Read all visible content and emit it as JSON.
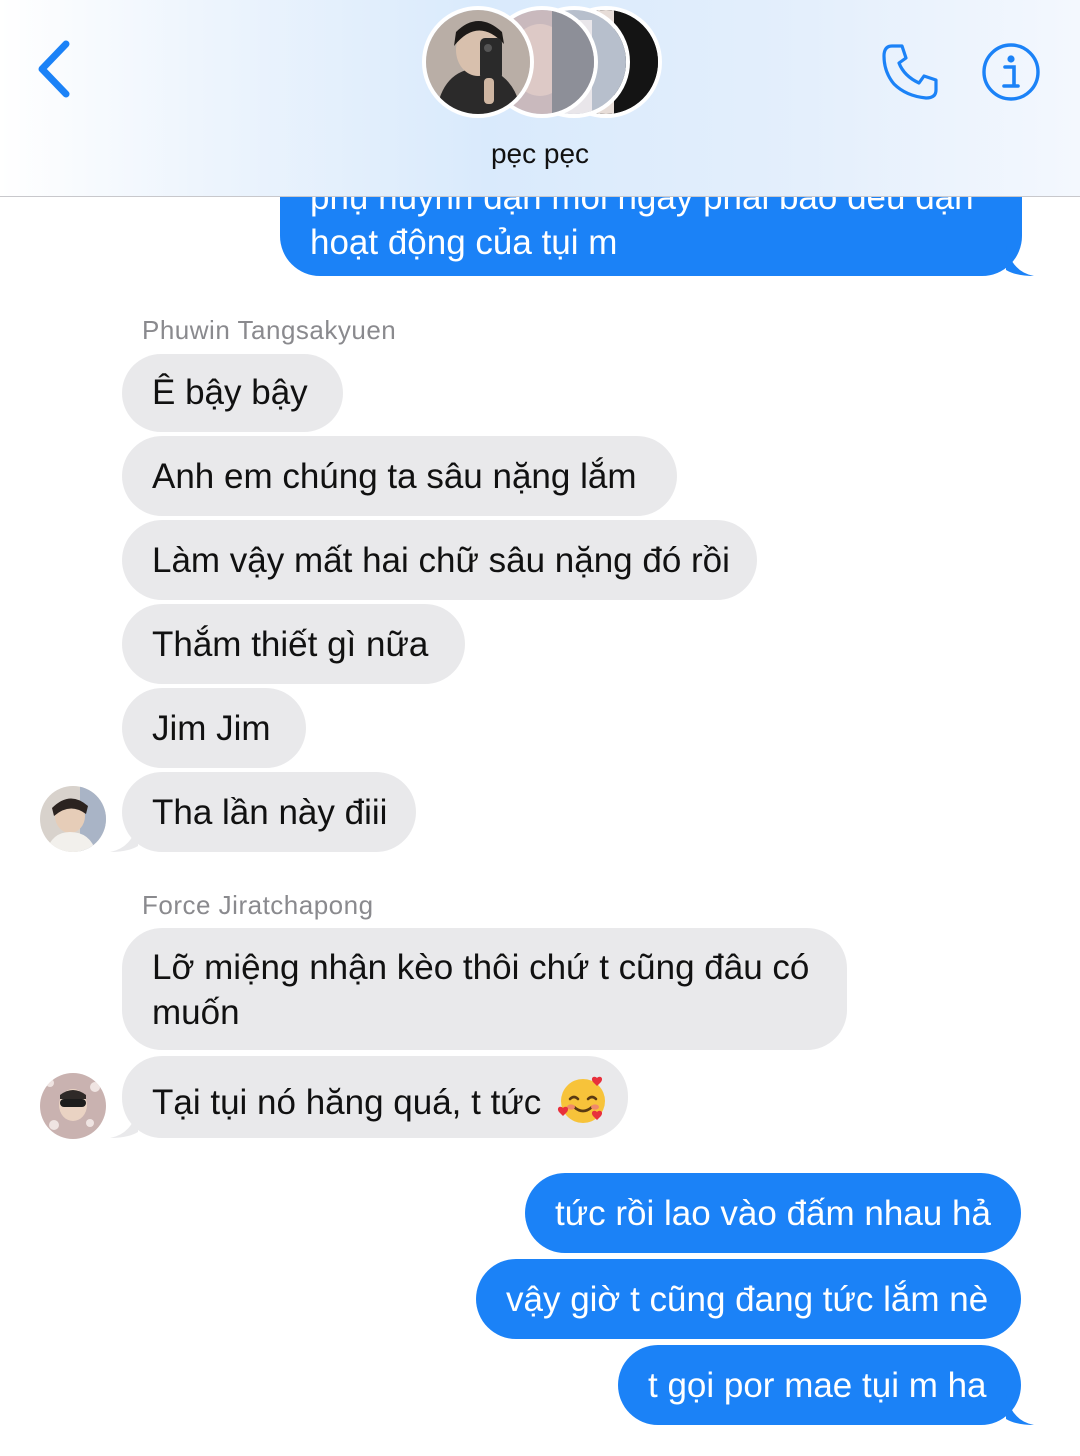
{
  "header": {
    "back_icon": "chevron-left-icon",
    "group_name": "pẹc pẹc",
    "call_icon": "phone-icon",
    "info_icon": "info-icon",
    "accent_color": "#1b82f7"
  },
  "messages": [
    {
      "direction": "outgoing",
      "text": "phụ huynh dặn mỗi ngày phải báo đều đặn",
      "partially_visible": true
    },
    {
      "direction": "outgoing",
      "text": "hoạt động của tụi m"
    },
    {
      "direction": "incoming",
      "sender": "Phuwin Tangsakyuen",
      "text": "Ê bậy bậy"
    },
    {
      "direction": "incoming",
      "text": "Anh em chúng ta sâu nặng lắm"
    },
    {
      "direction": "incoming",
      "text": "Làm vậy mất hai chữ sâu nặng đó rồi"
    },
    {
      "direction": "incoming",
      "text": "Thắm thiết gì nữa"
    },
    {
      "direction": "incoming",
      "text": "Jim Jim"
    },
    {
      "direction": "incoming",
      "text": "Tha lần này điii"
    },
    {
      "direction": "incoming",
      "sender": "Force Jiratchapong",
      "text": "Lỡ miệng nhận kèo thôi chứ t cũng đâu có muốn"
    },
    {
      "direction": "incoming",
      "text": "Tại tụi nó hăng quá, t tức",
      "emoji": "smiling-face-with-hearts"
    },
    {
      "direction": "outgoing",
      "text": "tức rồi lao vào đấm nhau hả"
    },
    {
      "direction": "outgoing",
      "text": "vậy giờ t cũng đang tức lắm nè"
    },
    {
      "direction": "outgoing",
      "text": "t gọi por mae tụi m ha"
    }
  ],
  "colors": {
    "incoming_bubble": "#e9e9eb",
    "outgoing_bubble": "#1b82f7",
    "sender_label": "#8a8a8e"
  }
}
